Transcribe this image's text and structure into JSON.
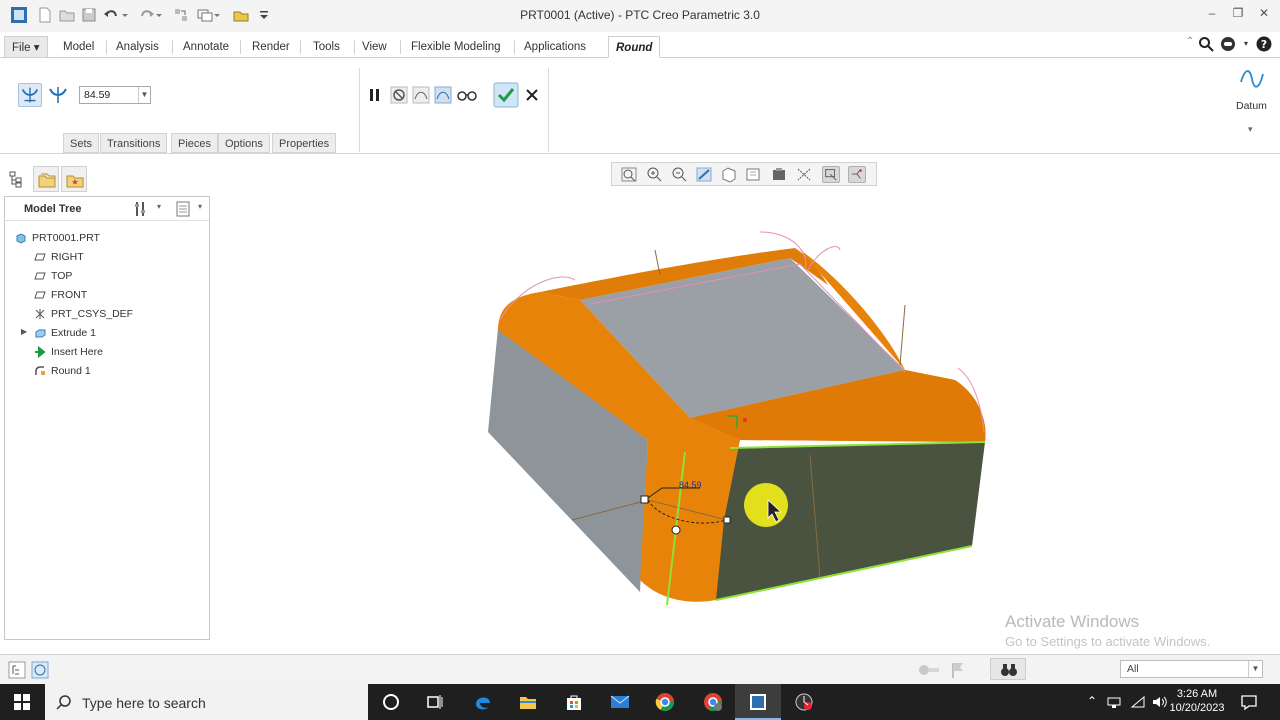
{
  "window": {
    "title": "PRT0001 (Active) - PTC Creo Parametric 3.0"
  },
  "ribbon_tabs": {
    "file": "File",
    "model": "Model",
    "analysis": "Analysis",
    "annotate": "Annotate",
    "render": "Render",
    "tools": "Tools",
    "view": "View",
    "flexible_modeling": "Flexible Modeling",
    "applications": "Applications",
    "round": "Round"
  },
  "round_tab": {
    "radius_value": "84.59",
    "subtabs": [
      "Sets",
      "Transitions",
      "Pieces",
      "Options",
      "Properties"
    ],
    "datum_label": "Datum"
  },
  "model_tree": {
    "header": "Model Tree",
    "items": [
      {
        "label": "PRT0001.PRT",
        "icon": "part-icon"
      },
      {
        "label": "RIGHT",
        "icon": "datum-plane-icon"
      },
      {
        "label": "TOP",
        "icon": "datum-plane-icon"
      },
      {
        "label": "FRONT",
        "icon": "datum-plane-icon"
      },
      {
        "label": "PRT_CSYS_DEF",
        "icon": "csys-icon"
      },
      {
        "label": "Extrude 1",
        "icon": "extrude-icon"
      },
      {
        "label": "Insert Here",
        "icon": "insert-arrow-icon"
      },
      {
        "label": "Round 1",
        "icon": "round-icon"
      }
    ]
  },
  "viewport": {
    "dimension_label": "84.59",
    "watermark_title": "Activate Windows",
    "watermark_subtitle": "Go to Settings to activate Windows."
  },
  "status_bar": {
    "filter_value": "All"
  },
  "taskbar": {
    "search_placeholder": "Type here to search",
    "time": "3:26 AM",
    "date": "10/20/2023"
  },
  "colors": {
    "round_surface": "#e8830a",
    "body_gray": "#8d949a",
    "selected_face": "#4a5340",
    "edge_highlight": "#8fe03a",
    "cursor_highlight": "#f3ef1a"
  }
}
